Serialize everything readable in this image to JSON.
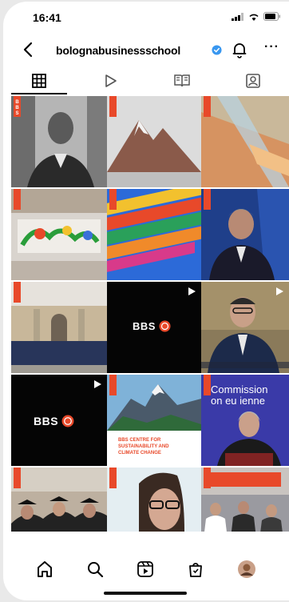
{
  "status_bar": {
    "time": "16:41"
  },
  "profile": {
    "username": "bolognabusinessschool",
    "verified": true
  },
  "tabs": [
    {
      "icon": "grid-icon",
      "active": true
    },
    {
      "icon": "reels-icon",
      "active": false
    },
    {
      "icon": "guides-icon",
      "active": false
    },
    {
      "icon": "tagged-icon",
      "active": false
    }
  ],
  "posts": {
    "row1": [
      "portrait",
      "mountain",
      "glass"
    ],
    "row2": [
      "mural",
      "pencils",
      "speaker"
    ],
    "row3": [
      "group-photo",
      "bbs-reel",
      "speaker-reel"
    ],
    "row4": [
      "bbs-logo",
      "mountain-snow",
      "commission"
    ],
    "row5": [
      "graduates",
      "woman-glasses",
      "panel"
    ],
    "bbs_label": "BBS",
    "center_caption": "BBS CENTRE FOR SUSTAINABILITY AND CLIMATE CHANGE",
    "commission_line1": "Commission",
    "commission_line2": "on eu",
    "commission_line3": "ienne"
  },
  "bottom_nav": [
    "home-icon",
    "search-icon",
    "reels-nav-icon",
    "shop-icon",
    "profile-avatar"
  ],
  "colors": {
    "accent": "#e8492a",
    "verified": "#3897f0",
    "text": "#000000"
  }
}
